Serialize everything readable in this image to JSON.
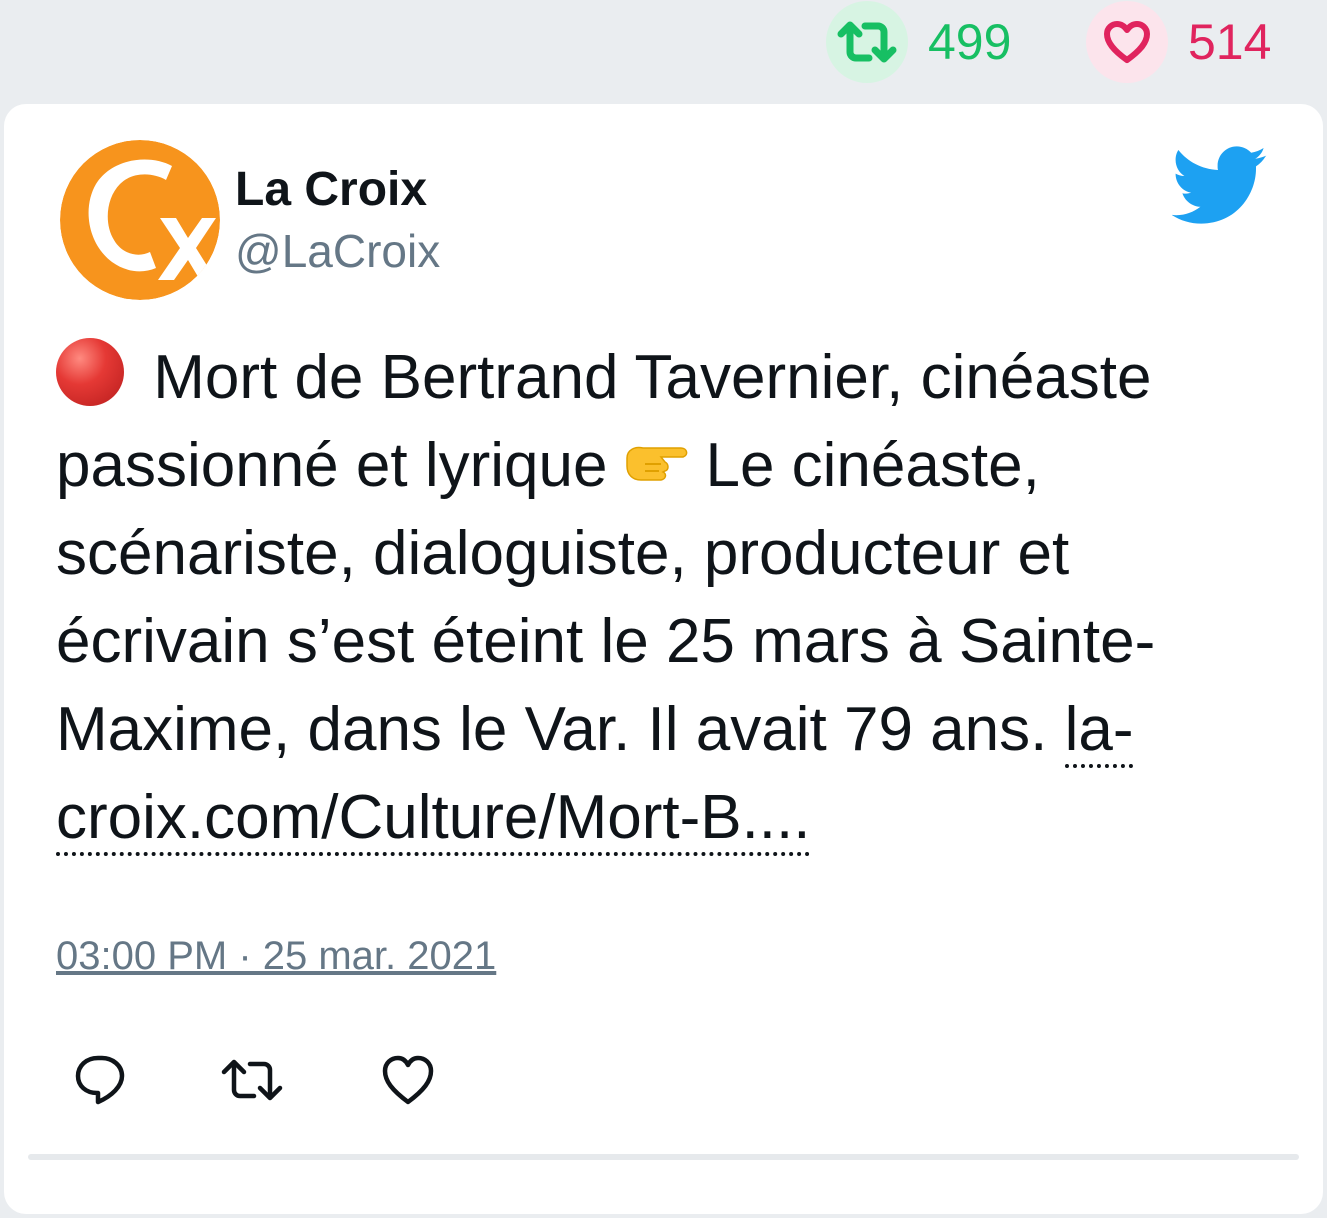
{
  "stats": {
    "retweet_count": "499",
    "like_count": "514",
    "retweet_color": "#17bf63",
    "like_color": "#e0245e"
  },
  "tweet": {
    "author_name": "La Croix",
    "author_handle": "@LaCroix",
    "avatar_icon": "la-croix-logo",
    "brand_icon": "twitter-bird-icon",
    "text_part1": " Mort de Bertrand Tavernier, cinéaste passionné et lyrique",
    "text_part2": "Le cinéaste, scénariste, dialoguiste, producteur et écrivain s’est éteint le 25 mars à Sainte-Maxime, dans le Var. Il avait 79 ans.",
    "link_text": "la-croix.com/Culture/Mort-B....",
    "timestamp": "03:00 PM · 25 mar. 2021"
  },
  "actions": {
    "reply_icon": "reply-icon",
    "retweet_icon": "retweet-icon",
    "like_icon": "heart-icon"
  }
}
